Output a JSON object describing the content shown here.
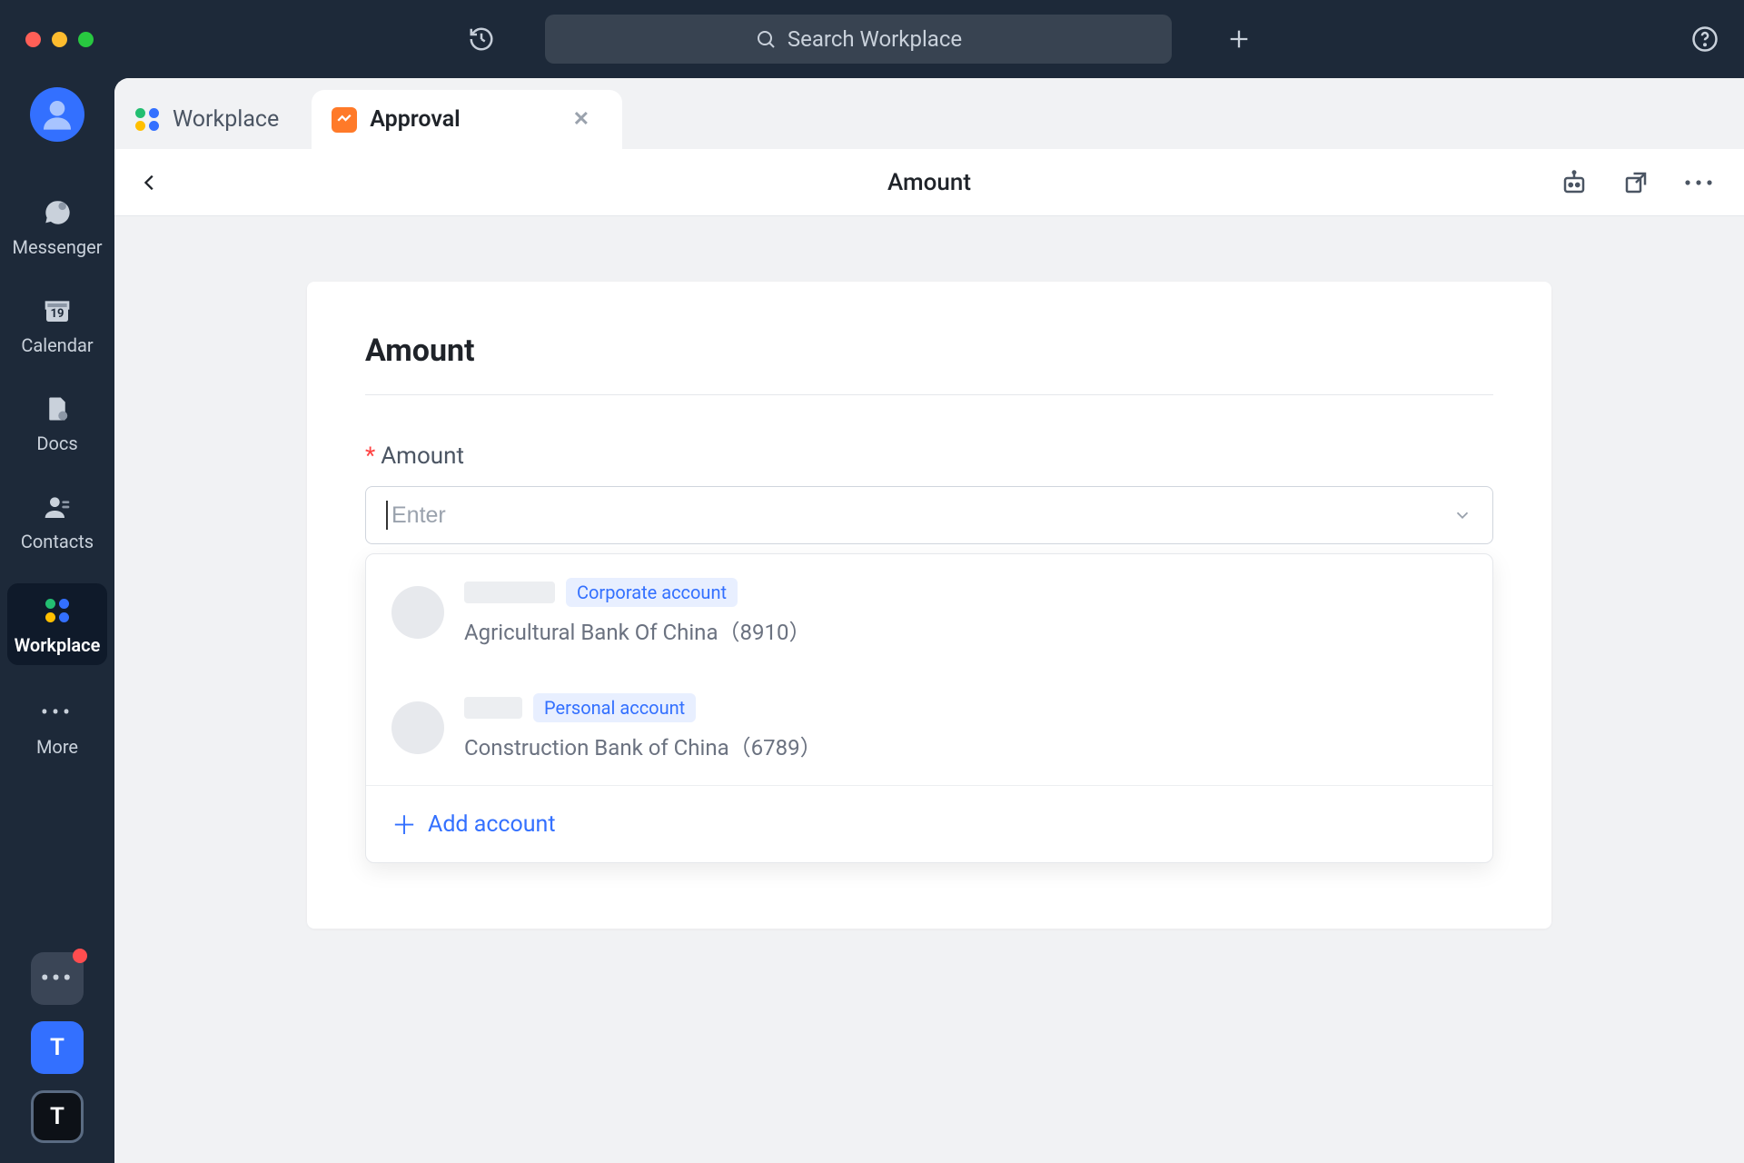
{
  "titlebar": {
    "search_placeholder": "Search Workplace"
  },
  "rail": {
    "items": [
      {
        "label": "Messenger"
      },
      {
        "label": "Calendar",
        "badge": "19"
      },
      {
        "label": "Docs"
      },
      {
        "label": "Contacts"
      },
      {
        "label": "Workplace"
      },
      {
        "label": "More"
      }
    ],
    "bottom_tiles": {
      "blue_letter": "T",
      "outline_letter": "T"
    }
  },
  "tabs": [
    {
      "label": "Workplace"
    },
    {
      "label": "Approval"
    }
  ],
  "page": {
    "title": "Amount",
    "card_heading": "Amount",
    "field_label": "Amount",
    "input_placeholder": "Enter",
    "dropdown": {
      "options": [
        {
          "badge": "Corporate account",
          "bank": "Agricultural Bank Of China",
          "suffix": "（8910）"
        },
        {
          "badge": "Personal account",
          "bank": "Construction Bank of China",
          "suffix": "（6789）"
        }
      ],
      "add_label": "Add account"
    }
  }
}
